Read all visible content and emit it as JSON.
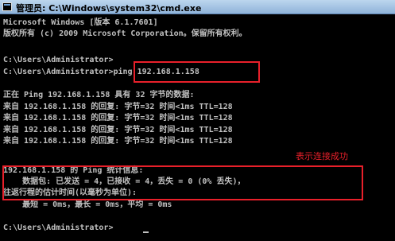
{
  "window": {
    "title": "管理员: C:\\Windows\\system32\\cmd.exe"
  },
  "console": {
    "lines": [
      "Microsoft Windows [版本 6.1.7601]",
      "版权所有 (c) 2009 Microsoft Corporation。保留所有权利。",
      "",
      "C:\\Users\\Administrator>",
      "C:\\Users\\Administrator>ping 192.168.1.158",
      "",
      "正在 Ping 192.168.1.158 具有 32 字节的数据:",
      "来自 192.168.1.158 的回复: 字节=32 时间<1ms TTL=128",
      "来自 192.168.1.158 的回复: 字节=32 时间<1ms TTL=128",
      "来自 192.168.1.158 的回复: 字节=32 时间<1ms TTL=128",
      "来自 192.168.1.158 的回复: 字节=32 时间<1ms TTL=128",
      "",
      "192.168.1.158 的 Ping 统计信息:",
      "    数据包: 已发送 = 4，已接收 = 4，丢失 = 0 (0% 丢失)，",
      "往返行程的估计时间(以毫秒为单位):",
      "    最短 = 0ms，最长 = 0ms，平均 = 0ms",
      "",
      "C:\\Users\\Administrator>"
    ]
  },
  "annotation": {
    "text": "表示连接成功",
    "color": "#e8202a"
  },
  "colors": {
    "console_bg": "#000000",
    "console_text": "#c0c0c0",
    "highlight": "#e8202a"
  }
}
